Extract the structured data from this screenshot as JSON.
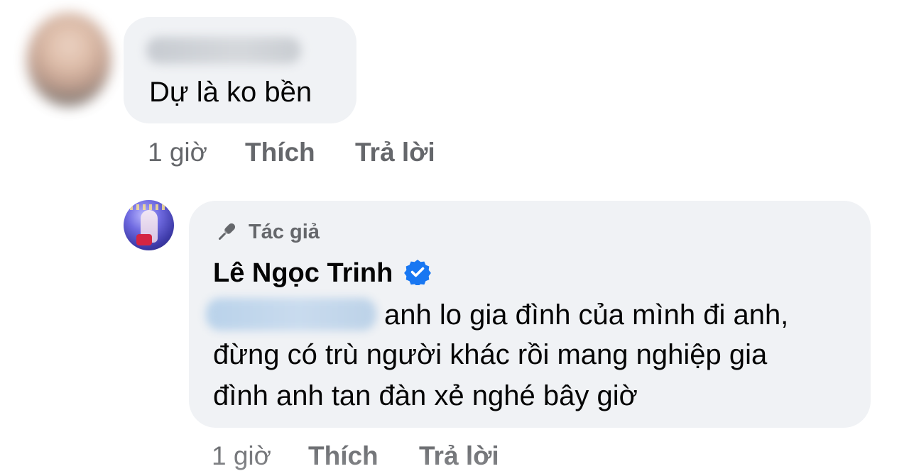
{
  "comments": [
    {
      "author_name_blurred": "",
      "text": "Dự là ko bền",
      "time": "1 giờ",
      "like_label": "Thích",
      "reply_label": "Trả lời"
    },
    {
      "badge_icon": "microphone-icon",
      "badge_label": "Tác giả",
      "author_name": "Lê Ngọc Trinh",
      "verified_icon": "verified-badge-icon",
      "mention_blurred": "",
      "text_lines": [
        "anh lo gia đình của mình đi anh,",
        "đừng có trù người khác rồi mang nghiệp gia",
        "đình anh tan đàn xẻ nghé bây giờ"
      ],
      "time": "1 giờ",
      "like_label": "Thích",
      "reply_label": "Trả lời"
    }
  ],
  "colors": {
    "bubble": "#f0f2f5",
    "meta_text": "#65676b",
    "main_text": "#050505",
    "verified": "#1877f2"
  }
}
